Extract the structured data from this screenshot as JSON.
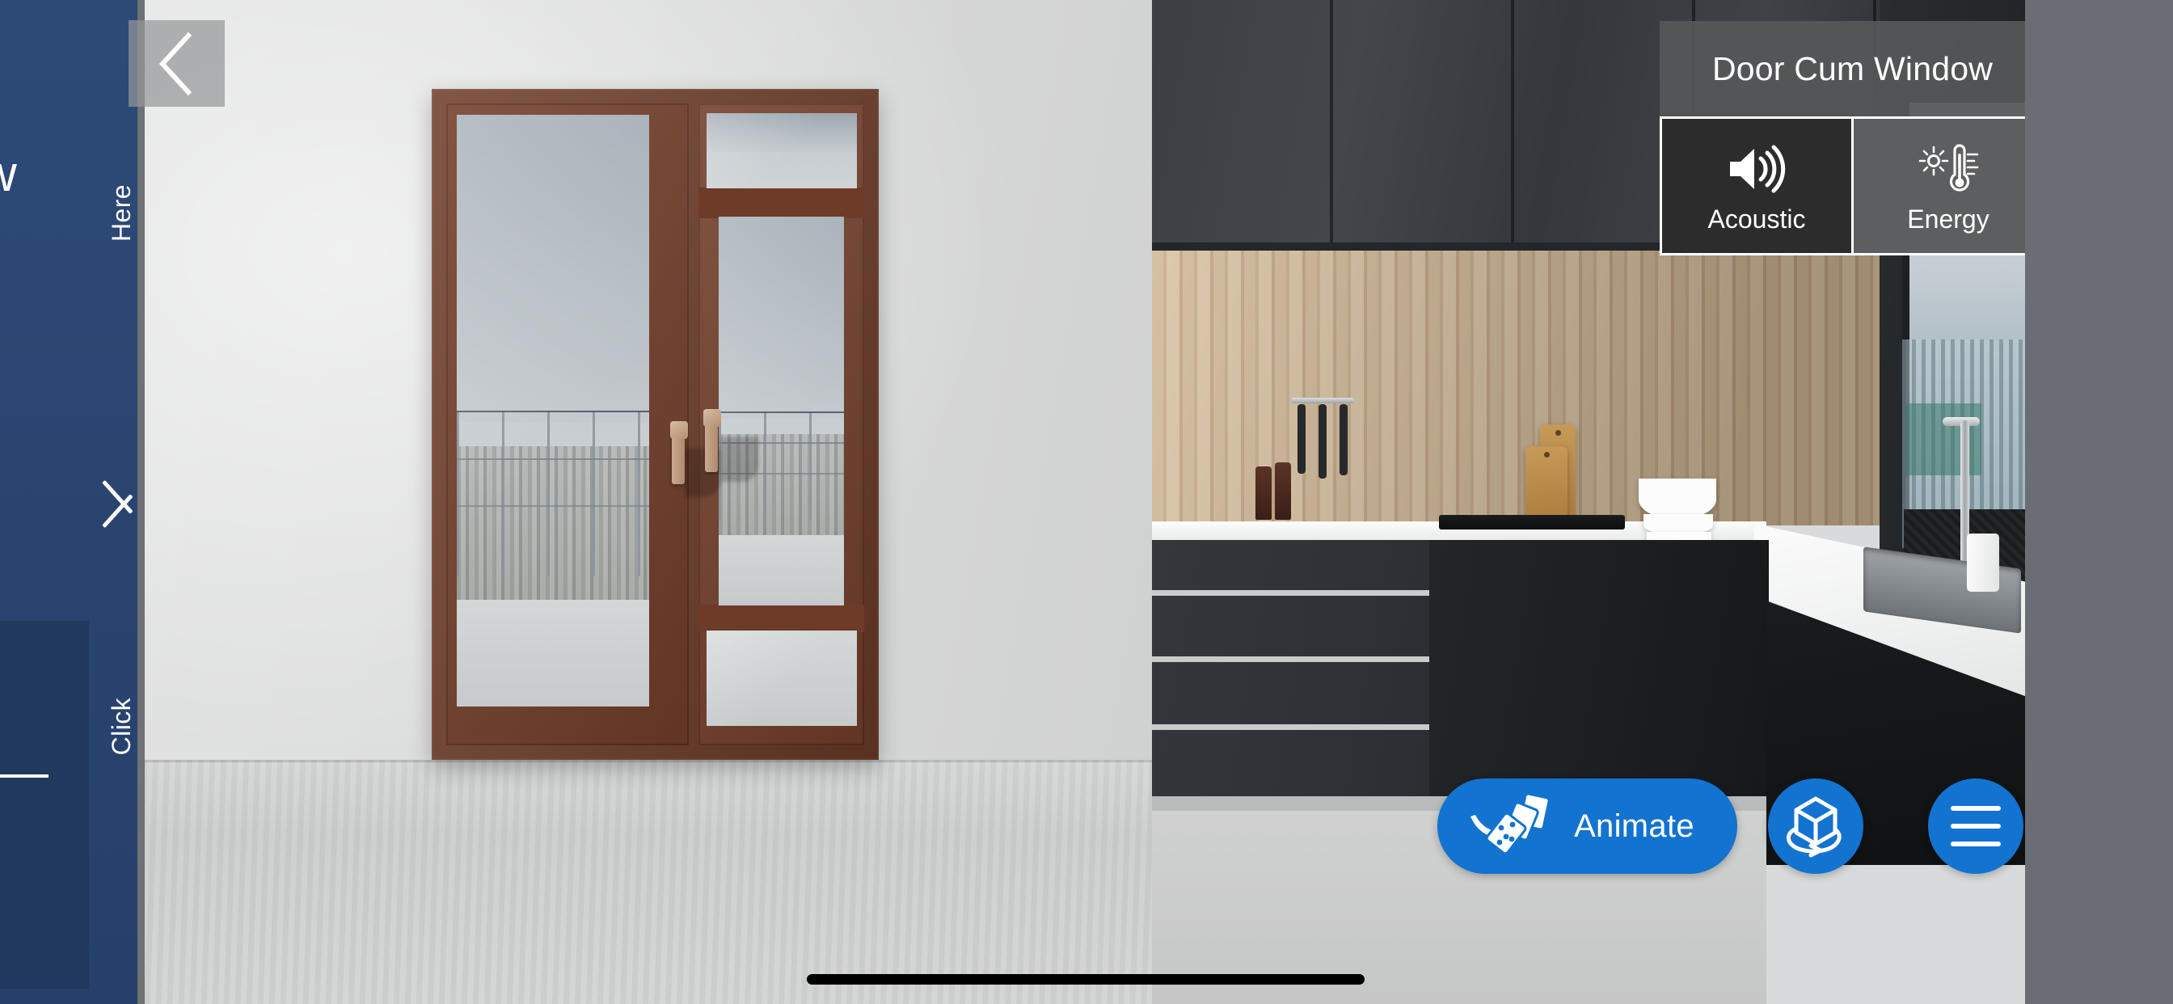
{
  "app": {
    "scene_description": "3D product configurator — brown door cum window rendered in a modern dark kitchen interior",
    "accent_color": "#1273d1",
    "sidebar_color": "#2b4571",
    "panel_color": "#565758",
    "selected_tile_color": "#2c2c2c"
  },
  "back_button": {
    "label": "Back",
    "icon": "chevron-left-icon"
  },
  "side_panel": {
    "clipped_glyph": "w",
    "top_label": "Here",
    "bottom_label": "Click",
    "chevron_icon": "chevron-right-icon"
  },
  "info_panel": {
    "title": "Door Cum Window",
    "tiles": [
      {
        "label": "Acoustic",
        "icon": "speaker-volume-icon",
        "selected": true
      },
      {
        "label": "Energy",
        "icon": "sun-thermometer-icon",
        "selected": false
      }
    ]
  },
  "actions": {
    "animate": {
      "label": "Animate",
      "icon": "falling-dominoes-icon"
    },
    "rotate": {
      "label": "Rotate 3D view",
      "icon": "rotate-cube-icon"
    },
    "menu": {
      "label": "Menu",
      "icon": "hamburger-menu-icon"
    }
  },
  "home_indicator": {
    "label": "Home indicator"
  },
  "product": {
    "name": "Door Cum Window",
    "frame_color": "#6d3b28",
    "handle_color": "#c9a98f",
    "panes": [
      "left-door-glass",
      "right-top-transom-glass",
      "right-middle-glass",
      "right-bottom-glass"
    ]
  }
}
